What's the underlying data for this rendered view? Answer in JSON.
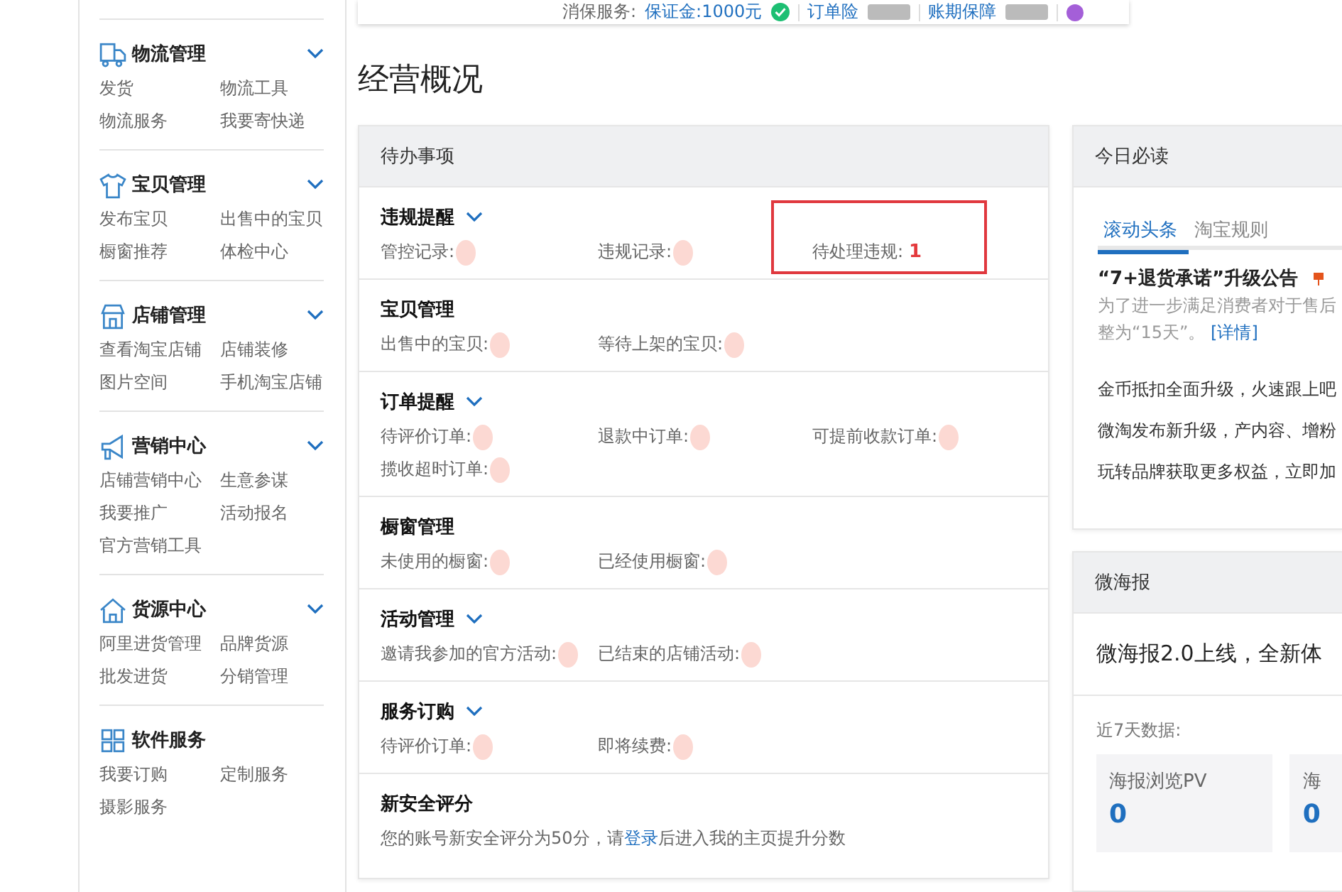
{
  "top_bar": {
    "label": "消保服务:",
    "deposit": "保证金:1000元",
    "deposit_verified": true,
    "services": [
      {
        "name": "订单险"
      },
      {
        "name": "账期保障"
      }
    ]
  },
  "page_title": "经营概况",
  "sidebar": {
    "sections": [
      {
        "title": "物流管理",
        "kind": "truck",
        "expandable": true,
        "links": [
          "发货",
          "物流工具",
          "物流服务",
          "我要寄快递"
        ]
      },
      {
        "title": "宝贝管理",
        "kind": "shirt",
        "expandable": true,
        "links": [
          "发布宝贝",
          "出售中的宝贝",
          "橱窗推荐",
          "体检中心"
        ]
      },
      {
        "title": "店铺管理",
        "kind": "store",
        "expandable": true,
        "links": [
          "查看淘宝店铺",
          "店铺装修",
          "图片空间",
          "手机淘宝店铺"
        ]
      },
      {
        "title": "营销中心",
        "kind": "megaphone",
        "expandable": true,
        "links": [
          "店铺营销中心",
          "生意参谋",
          "我要推广",
          "活动报名",
          "官方营销工具"
        ]
      },
      {
        "title": "货源中心",
        "kind": "house",
        "expandable": true,
        "links": [
          "阿里进货管理",
          "品牌货源",
          "批发进货",
          "分销管理"
        ]
      },
      {
        "title": "软件服务",
        "kind": "grid",
        "expandable": false,
        "links": [
          "我要订购",
          "定制服务",
          "摄影服务"
        ]
      }
    ]
  },
  "todo": {
    "title": "待办事项",
    "sections": [
      {
        "title": "违规提醒",
        "expandable": true,
        "items": [
          {
            "label": "管控记录:",
            "kind": "redacted",
            "highlighted": false
          },
          {
            "label": "违规记录:",
            "kind": "redacted",
            "highlighted": false
          },
          {
            "label": "待处理违规:",
            "kind": "value",
            "value": "1",
            "highlighted": true
          }
        ]
      },
      {
        "title": "宝贝管理",
        "expandable": false,
        "items": [
          {
            "label": "出售中的宝贝:",
            "kind": "redacted",
            "highlighted": false
          },
          {
            "label": "等待上架的宝贝:",
            "kind": "redacted",
            "highlighted": false
          }
        ]
      },
      {
        "title": "订单提醒",
        "expandable": true,
        "items": [
          {
            "label": "待评价订单:",
            "kind": "redacted",
            "highlighted": false
          },
          {
            "label": "退款中订单:",
            "kind": "redacted",
            "highlighted": false
          },
          {
            "label": "可提前收款订单:",
            "kind": "redacted",
            "highlighted": false
          },
          {
            "label": "揽收超时订单:",
            "kind": "redacted",
            "highlighted": false
          }
        ]
      },
      {
        "title": "橱窗管理",
        "expandable": false,
        "items": [
          {
            "label": "未使用的橱窗:",
            "kind": "redacted",
            "highlighted": false
          },
          {
            "label": "已经使用橱窗:",
            "kind": "redacted",
            "highlighted": false
          }
        ]
      },
      {
        "title": "活动管理",
        "expandable": true,
        "items": [
          {
            "label": "邀请我参加的官方活动:",
            "kind": "redacted",
            "highlighted": false
          },
          {
            "label": "已结束的店铺活动:",
            "kind": "redacted",
            "highlighted": false
          }
        ]
      },
      {
        "title": "服务订购",
        "expandable": true,
        "items": [
          {
            "label": "待评价订单:",
            "kind": "redacted",
            "highlighted": false
          },
          {
            "label": "即将续费:",
            "kind": "redacted",
            "highlighted": false
          }
        ]
      }
    ],
    "security": {
      "title": "新安全评分",
      "text_before": "您的账号新安全评分为50分，请",
      "link": "登录",
      "text_after": "后进入我的主页提升分数"
    }
  },
  "today": {
    "title": "今日必读",
    "tabs": [
      {
        "label": "滚动头条",
        "selected": true
      },
      {
        "label": "淘宝规则",
        "selected": false
      }
    ],
    "headline": {
      "title": "“7+退货承诺”升级公告",
      "summary_1": "为了进一步满足消费者对于售后",
      "summary_2": "整为“15天”。",
      "link": "[详情]"
    },
    "news": [
      "金币抵扣全面升级，火速跟上吧",
      "微淘发布新升级，产内容、增粉",
      "玩转品牌获取更多权益，立即加"
    ]
  },
  "poster": {
    "title": "微海报",
    "banner": "微海报2.0上线，全新体",
    "stats_label": "近7天数据:",
    "stats": [
      {
        "label": "海报浏览PV",
        "value": "0"
      },
      {
        "label": "海",
        "value": "0"
      }
    ]
  }
}
